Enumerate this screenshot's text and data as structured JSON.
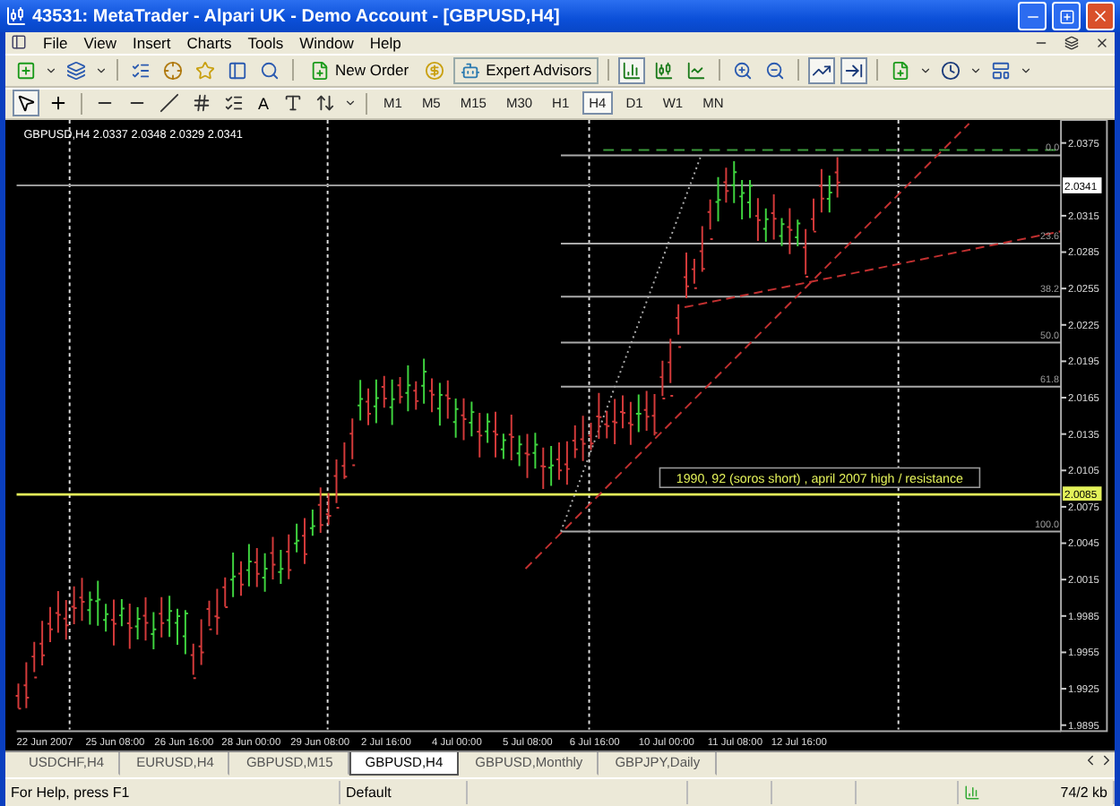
{
  "window": {
    "title": "43531: MetaTrader - Alpari UK - Demo Account - [GBPUSD,H4]"
  },
  "menu": [
    "File",
    "View",
    "Insert",
    "Charts",
    "Tools",
    "Window",
    "Help"
  ],
  "toolbar": {
    "new_order": "New Order",
    "expert_advisors": "Expert Advisors"
  },
  "drawing_tools": {
    "text_tool": "A"
  },
  "timeframes": [
    {
      "label": "M1",
      "selected": false
    },
    {
      "label": "M5",
      "selected": false
    },
    {
      "label": "M15",
      "selected": false
    },
    {
      "label": "M30",
      "selected": false
    },
    {
      "label": "H1",
      "selected": false
    },
    {
      "label": "H4",
      "selected": true
    },
    {
      "label": "D1",
      "selected": false
    },
    {
      "label": "W1",
      "selected": false
    },
    {
      "label": "MN",
      "selected": false
    }
  ],
  "chart": {
    "legend": "GBPUSD,H4  2.0337 2.0348 2.0329 2.0341",
    "price_labels": [
      "2.0375",
      "2.0315",
      "2.0285",
      "2.0255",
      "2.0225",
      "2.0195",
      "2.0165",
      "2.0135",
      "2.0105",
      "2.0075",
      "2.0045",
      "2.0015",
      "1.9985",
      "1.9955",
      "1.9925",
      "1.9895"
    ],
    "bid_badge": "2.0341",
    "line_badge": "2.0085",
    "fib_levels": [
      "0.0",
      "23.6",
      "38.2",
      "50.0",
      "61.8",
      "100.0"
    ],
    "annotation": "1990, 92 (soros short) , april 2007 high / resistance",
    "time_labels": [
      "22 Jun 2007",
      "25 Jun 08:00",
      "26 Jun 16:00",
      "28 Jun 00:00",
      "29 Jun 08:00",
      "2 Jul 16:00",
      "4 Jul 00:00",
      "5 Jul 08:00",
      "6 Jul 16:00",
      "10 Jul 00:00",
      "11 Jul 08:00",
      "12 Jul 16:00"
    ]
  },
  "tabs": [
    {
      "label": "USDCHF,H4",
      "selected": false
    },
    {
      "label": "EURUSD,H4",
      "selected": false
    },
    {
      "label": "GBPUSD,M15",
      "selected": false
    },
    {
      "label": "GBPUSD,H4",
      "selected": true
    },
    {
      "label": "GBPUSD,Monthly",
      "selected": false
    },
    {
      "label": "GBPJPY,Daily",
      "selected": false
    }
  ],
  "status_bar": {
    "help": "For Help, press F1",
    "profile": "Default",
    "traffic": "74/2 kb"
  }
}
